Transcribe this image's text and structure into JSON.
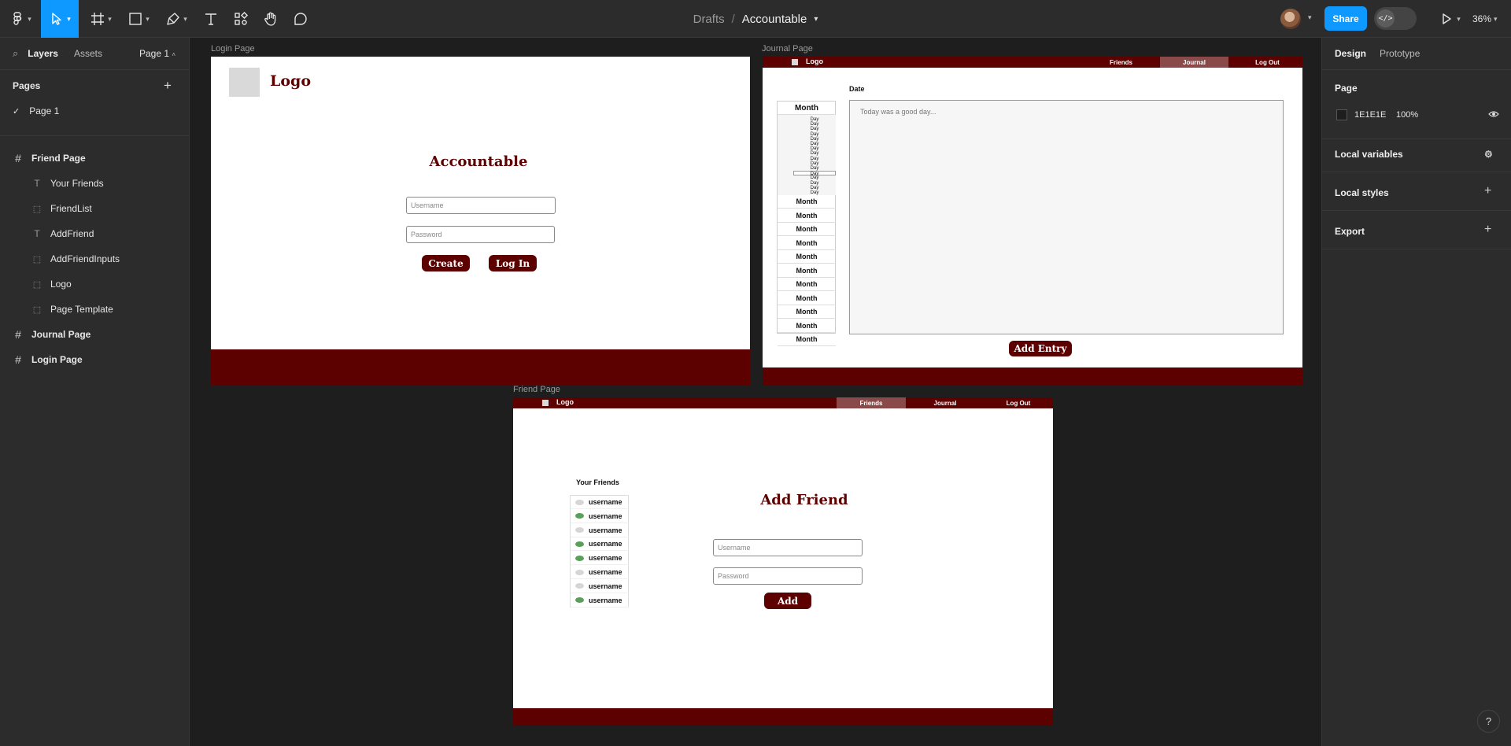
{
  "toolbar": {
    "breadcrumb_drafts": "Drafts",
    "breadcrumb_sep": "/",
    "file_name": "Accountable",
    "share_label": "Share",
    "devmode_icon": "</>",
    "zoom_label": "36%"
  },
  "left_panel": {
    "tabs": [
      "Layers",
      "Assets"
    ],
    "page_selector": "Page 1",
    "pages_heading": "Pages",
    "pages": [
      "Page 1"
    ],
    "layers": [
      {
        "label": "Friend Page",
        "kind": "frame",
        "level": 0
      },
      {
        "label": "Your Friends",
        "kind": "text",
        "level": 1
      },
      {
        "label": "FriendList",
        "kind": "group",
        "level": 1
      },
      {
        "label": "AddFriend",
        "kind": "text",
        "level": 1
      },
      {
        "label": "AddFriendInputs",
        "kind": "group",
        "level": 1
      },
      {
        "label": "Logo",
        "kind": "group",
        "level": 1
      },
      {
        "label": "Page Template",
        "kind": "group",
        "level": 1
      },
      {
        "label": "Journal Page",
        "kind": "frame",
        "level": 0
      },
      {
        "label": "Login Page",
        "kind": "frame",
        "level": 0
      }
    ]
  },
  "right_panel": {
    "tabs": [
      "Design",
      "Prototype"
    ],
    "page_heading": "Page",
    "page_color_hex": "1E1E1E",
    "page_opacity": "100%",
    "local_variables": "Local variables",
    "local_styles": "Local styles",
    "export": "Export"
  },
  "login_frame": {
    "label": "Login Page",
    "logo": "Logo",
    "title": "Accountable",
    "username_placeholder": "Username",
    "password_placeholder": "Password",
    "create_label": "Create",
    "login_label": "Log In"
  },
  "journal_frame": {
    "label": "Journal Page",
    "logo": "Logo",
    "nav": [
      "Friends",
      "Journal",
      "Log Out"
    ],
    "date_label": "Date",
    "entry_placeholder": "Today was a good day...",
    "month_header": "Month",
    "day_label": "Day",
    "months": [
      "Month",
      "Month",
      "Month",
      "Month",
      "Month",
      "Month",
      "Month",
      "Month",
      "Month",
      "Month",
      "Month"
    ],
    "add_entry_label": "Add Entry"
  },
  "friend_frame": {
    "label": "Friend Page",
    "logo": "Logo",
    "nav": [
      "Friends",
      "Journal",
      "Log Out"
    ],
    "your_friends": "Your Friends",
    "friends": [
      {
        "name": "username",
        "online": false
      },
      {
        "name": "username",
        "online": true
      },
      {
        "name": "username",
        "online": false
      },
      {
        "name": "username",
        "online": true
      },
      {
        "name": "username",
        "online": true
      },
      {
        "name": "username",
        "online": false
      },
      {
        "name": "username",
        "online": false
      },
      {
        "name": "username",
        "online": true
      }
    ],
    "title": "Add Friend",
    "username_placeholder": "Username",
    "password_placeholder": "Password",
    "add_label": "Add"
  },
  "help_label": "?",
  "colors": {
    "accent": "#0d99ff",
    "brand_maroon": "#5c0000",
    "online": "#5aa05a",
    "offline": "#d6d6d6"
  }
}
